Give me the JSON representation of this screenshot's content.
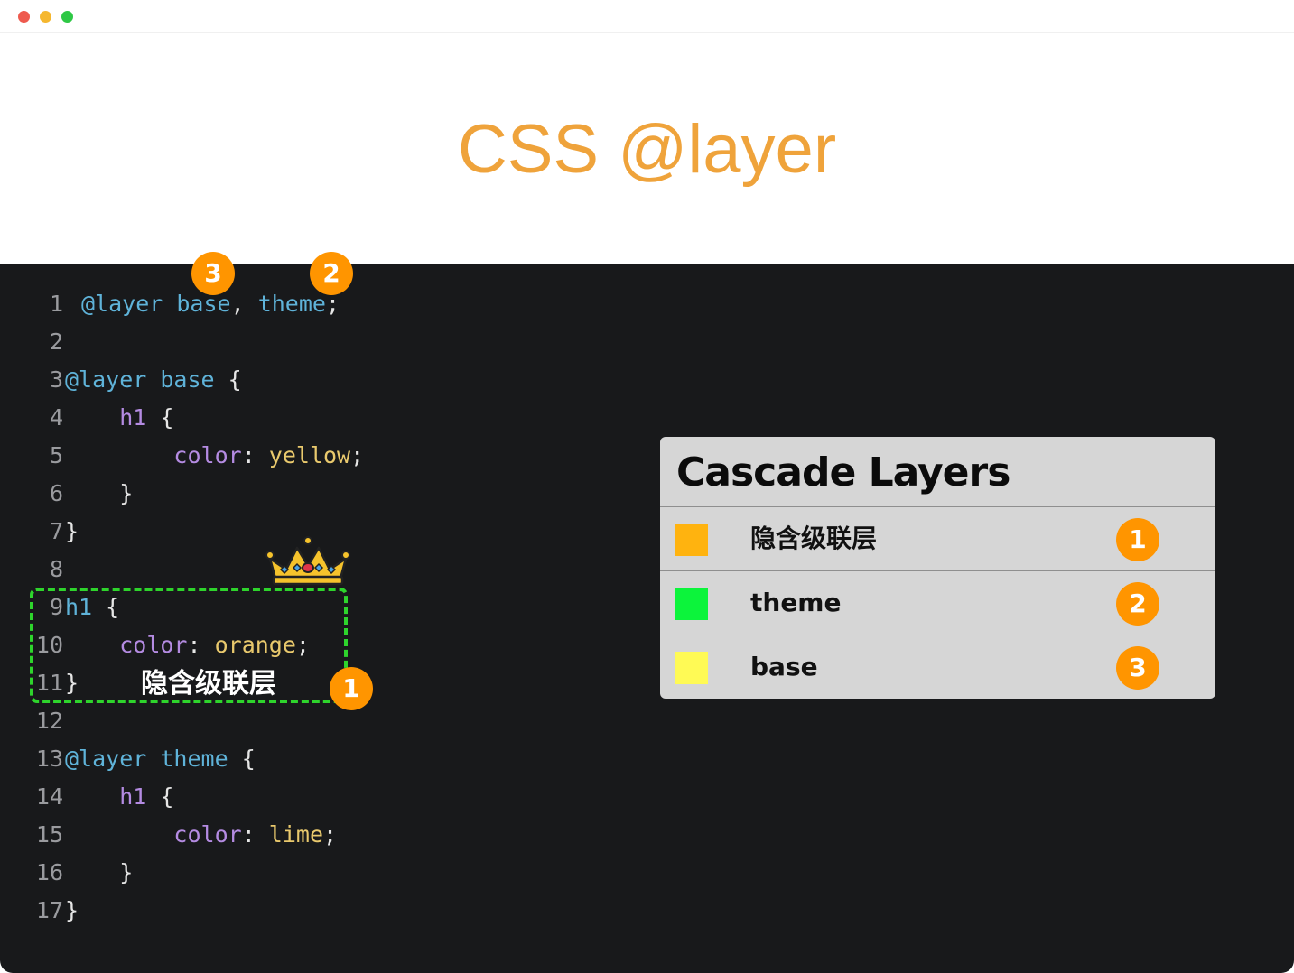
{
  "window": {
    "title_dots": [
      "close",
      "minimize",
      "maximize"
    ]
  },
  "title": "CSS @layer",
  "code_lines": [
    {
      "n": "1",
      "parts": [
        [
          "kw",
          "@layer"
        ],
        [
          "punc",
          " "
        ],
        [
          "kw",
          "base"
        ],
        [
          "punc",
          ", "
        ],
        [
          "kw",
          "theme"
        ],
        [
          "punc",
          ";"
        ]
      ]
    },
    {
      "n": "2",
      "parts": []
    },
    {
      "n": "3",
      "parts": [
        [
          "kw",
          "@layer"
        ],
        [
          "punc",
          " "
        ],
        [
          "kw",
          "base"
        ],
        [
          "punc",
          " {"
        ]
      ]
    },
    {
      "n": "4",
      "parts": [
        [
          "punc",
          "    "
        ],
        [
          "prop",
          "h1"
        ],
        [
          "punc",
          " {"
        ]
      ]
    },
    {
      "n": "5",
      "parts": [
        [
          "punc",
          "        "
        ],
        [
          "prop",
          "color"
        ],
        [
          "punc",
          ": "
        ],
        [
          "val",
          "yellow"
        ],
        [
          "punc",
          ";"
        ]
      ]
    },
    {
      "n": "6",
      "parts": [
        [
          "punc",
          "    }"
        ]
      ]
    },
    {
      "n": "7",
      "parts": [
        [
          "punc",
          "}"
        ]
      ]
    },
    {
      "n": "8",
      "parts": []
    },
    {
      "n": "9",
      "parts": [
        [
          "kw",
          "h1"
        ],
        [
          "punc",
          " {"
        ]
      ]
    },
    {
      "n": "10",
      "parts": [
        [
          "punc",
          "    "
        ],
        [
          "prop",
          "color"
        ],
        [
          "punc",
          ": "
        ],
        [
          "val",
          "orange"
        ],
        [
          "punc",
          ";"
        ]
      ]
    },
    {
      "n": "11",
      "parts": [
        [
          "punc",
          "}"
        ]
      ]
    },
    {
      "n": "12",
      "parts": []
    },
    {
      "n": "13",
      "parts": [
        [
          "kw",
          "@layer"
        ],
        [
          "punc",
          " "
        ],
        [
          "kw",
          "theme"
        ],
        [
          "punc",
          " {"
        ]
      ]
    },
    {
      "n": "14",
      "parts": [
        [
          "punc",
          "    "
        ],
        [
          "prop",
          "h1"
        ],
        [
          "punc",
          " {"
        ]
      ]
    },
    {
      "n": "15",
      "parts": [
        [
          "punc",
          "        "
        ],
        [
          "prop",
          "color"
        ],
        [
          "punc",
          ": "
        ],
        [
          "val",
          "lime"
        ],
        [
          "punc",
          ";"
        ]
      ]
    },
    {
      "n": "16",
      "parts": [
        [
          "punc",
          "    }"
        ]
      ]
    },
    {
      "n": "17",
      "parts": [
        [
          "punc",
          "}"
        ]
      ]
    }
  ],
  "code_badges": {
    "base": "3",
    "theme": "2",
    "implicit": "1"
  },
  "implicit_label": "隐含级联层",
  "panel": {
    "title": "Cascade Layers",
    "rows": [
      {
        "label": "隐含级联层",
        "badge": "1",
        "color": "#ffb30f"
      },
      {
        "label": "theme",
        "badge": "2",
        "color": "#0cf43b"
      },
      {
        "label": "base",
        "badge": "3",
        "color": "#fffa55"
      }
    ]
  },
  "colors": {
    "accent": "#ff9500",
    "title": "#efa33b",
    "dashed_border": "#2ed42c"
  }
}
